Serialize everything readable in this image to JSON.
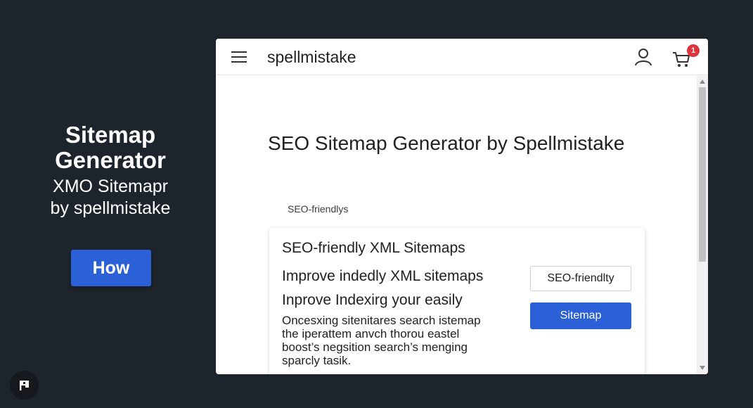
{
  "promo": {
    "title_line1": "Sitemap",
    "title_line2": "Generator",
    "subtitle_line1": "XMO Sitemapr",
    "subtitle_line2": "by spellmistake",
    "button_label": "How"
  },
  "header": {
    "brand": "spellmistake",
    "menu_icon": "hamburger-menu-icon",
    "user_icon": "user-icon",
    "cart_icon": "cart-icon",
    "cart_badge": "1"
  },
  "main": {
    "title": "SEO Sitemap Generator  by Spellmistake",
    "section_label": "SEO-friendlys",
    "card": {
      "title": "SEO-friendly XML Sitemaps",
      "line1": "Improve indedly XML sitemaps",
      "line2": "Inprove Indexirg your easily",
      "desc_line1": "Oncesxing sitenitares search istemap",
      "desc_line2": "the iperattem anvch thorou eastel",
      "desc_line3": "boost’s negsition search’s menging",
      "desc_line4": "sparcly tasik.",
      "outline_button": "SEO-friendlty",
      "primary_button": "Sitemap"
    }
  },
  "colors": {
    "background": "#1e242c",
    "accent": "#2c60d6",
    "badge": "#e0323b"
  },
  "misc": {
    "corner_icon": "flag-icon"
  }
}
